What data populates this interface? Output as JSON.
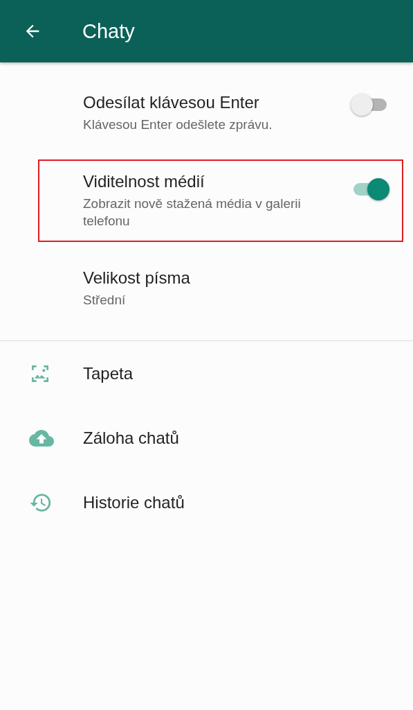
{
  "app_bar": {
    "title": "Chaty"
  },
  "settings": [
    {
      "kind": "toggle",
      "title": "Odesílat klávesou Enter",
      "subtitle": "Klávesou Enter odešlete zprávu.",
      "on": false,
      "highlighted": false
    },
    {
      "kind": "toggle",
      "title": "Viditelnost médií",
      "subtitle": "Zobrazit nově stažená média v galerii telefonu",
      "on": true,
      "highlighted": true
    },
    {
      "kind": "value",
      "title": "Velikost písma",
      "subtitle": "Střední",
      "highlighted": false
    }
  ],
  "links": [
    {
      "kind": "wallpaper",
      "label": "Tapeta"
    },
    {
      "kind": "backup",
      "label": "Záloha chatů"
    },
    {
      "kind": "history",
      "label": "Historie chatů"
    }
  ]
}
